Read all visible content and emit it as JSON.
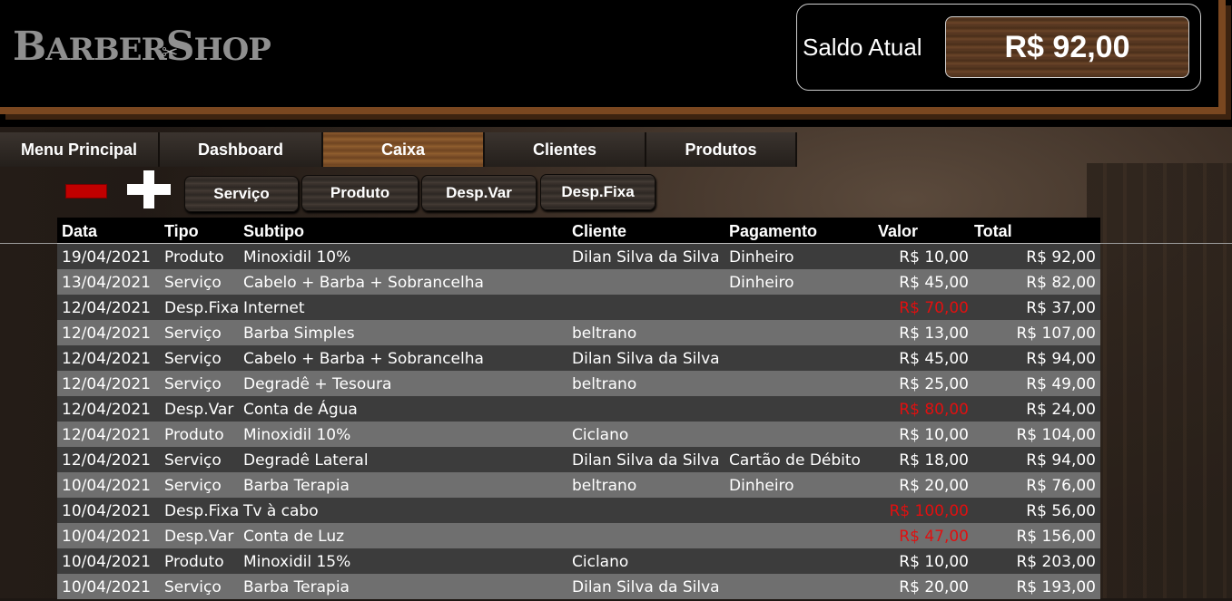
{
  "header": {
    "logo_big1": "B",
    "logo_small1": "ARBER",
    "logo_big2": "S",
    "logo_small2": "HOP",
    "saldo_label": "Saldo Atual",
    "saldo_value": "R$ 92,00"
  },
  "nav": {
    "tabs": [
      "Menu Principal",
      "Dashboard",
      "Caixa",
      "Clientes",
      "Produtos"
    ],
    "active": "Caixa"
  },
  "actions": {
    "buttons": [
      "Serviço",
      "Produto",
      "Desp.Var",
      "Desp.Fixa"
    ]
  },
  "table": {
    "headers": {
      "data": "Data",
      "tipo": "Tipo",
      "subtipo": "Subtipo",
      "cliente": "Cliente",
      "pagamento": "Pagamento",
      "valor": "Valor",
      "total": "Total"
    },
    "rows": [
      {
        "data": "19/04/2021",
        "tipo": "Produto",
        "subtipo": "Minoxidil 10%",
        "cliente": "Dilan Silva da Silva",
        "pagamento": "Dinheiro",
        "valor": "R$ 10,00",
        "total": "R$ 92,00",
        "negative": false
      },
      {
        "data": "13/04/2021",
        "tipo": "Serviço",
        "subtipo": "Cabelo + Barba + Sobrancelha",
        "cliente": "",
        "pagamento": "Dinheiro",
        "valor": "R$ 45,00",
        "total": "R$ 82,00",
        "negative": false
      },
      {
        "data": "12/04/2021",
        "tipo": "Desp.Fixa",
        "subtipo": "Internet",
        "cliente": "",
        "pagamento": "",
        "valor": "R$ 70,00",
        "total": "R$ 37,00",
        "negative": true
      },
      {
        "data": "12/04/2021",
        "tipo": "Serviço",
        "subtipo": "Barba Simples",
        "cliente": "beltrano",
        "pagamento": "",
        "valor": "R$ 13,00",
        "total": "R$ 107,00",
        "negative": false
      },
      {
        "data": "12/04/2021",
        "tipo": "Serviço",
        "subtipo": "Cabelo + Barba + Sobrancelha",
        "cliente": "Dilan Silva da Silva",
        "pagamento": "",
        "valor": "R$ 45,00",
        "total": "R$ 94,00",
        "negative": false
      },
      {
        "data": "12/04/2021",
        "tipo": "Serviço",
        "subtipo": "Degradê + Tesoura",
        "cliente": "beltrano",
        "pagamento": "",
        "valor": "R$ 25,00",
        "total": "R$ 49,00",
        "negative": false
      },
      {
        "data": "12/04/2021",
        "tipo": "Desp.Var",
        "subtipo": "Conta de Água",
        "cliente": "",
        "pagamento": "",
        "valor": "R$ 80,00",
        "total": "R$ 24,00",
        "negative": true
      },
      {
        "data": "12/04/2021",
        "tipo": "Produto",
        "subtipo": "Minoxidil 10%",
        "cliente": "Ciclano",
        "pagamento": "",
        "valor": "R$ 10,00",
        "total": "R$ 104,00",
        "negative": false
      },
      {
        "data": "12/04/2021",
        "tipo": "Serviço",
        "subtipo": "Degradê Lateral",
        "cliente": "Dilan Silva da Silva",
        "pagamento": "Cartão de Débito",
        "valor": "R$ 18,00",
        "total": "R$ 94,00",
        "negative": false
      },
      {
        "data": "10/04/2021",
        "tipo": "Serviço",
        "subtipo": "Barba Terapia",
        "cliente": "beltrano",
        "pagamento": "Dinheiro",
        "valor": "R$ 20,00",
        "total": "R$ 76,00",
        "negative": false
      },
      {
        "data": "10/04/2021",
        "tipo": "Desp.Fixa",
        "subtipo": "Tv à cabo",
        "cliente": "",
        "pagamento": "",
        "valor": "R$ 100,00",
        "total": "R$ 56,00",
        "negative": true
      },
      {
        "data": "10/04/2021",
        "tipo": "Desp.Var",
        "subtipo": "Conta de Luz",
        "cliente": "",
        "pagamento": "",
        "valor": "R$ 47,00",
        "total": "R$ 156,00",
        "negative": true
      },
      {
        "data": "10/04/2021",
        "tipo": "Produto",
        "subtipo": "Minoxidil 15%",
        "cliente": "Ciclano",
        "pagamento": "",
        "valor": "R$ 10,00",
        "total": "R$ 203,00",
        "negative": false
      },
      {
        "data": "10/04/2021",
        "tipo": "Serviço",
        "subtipo": "Barba Terapia",
        "cliente": "Dilan Silva da Silva",
        "pagamento": "",
        "valor": "R$ 20,00",
        "total": "R$ 193,00",
        "negative": false
      }
    ]
  },
  "colors": {
    "accent_brown": "#7a4720",
    "negative": "#e01010",
    "row_dark": "#3c3c3c",
    "row_light": "#6f6f6f"
  }
}
